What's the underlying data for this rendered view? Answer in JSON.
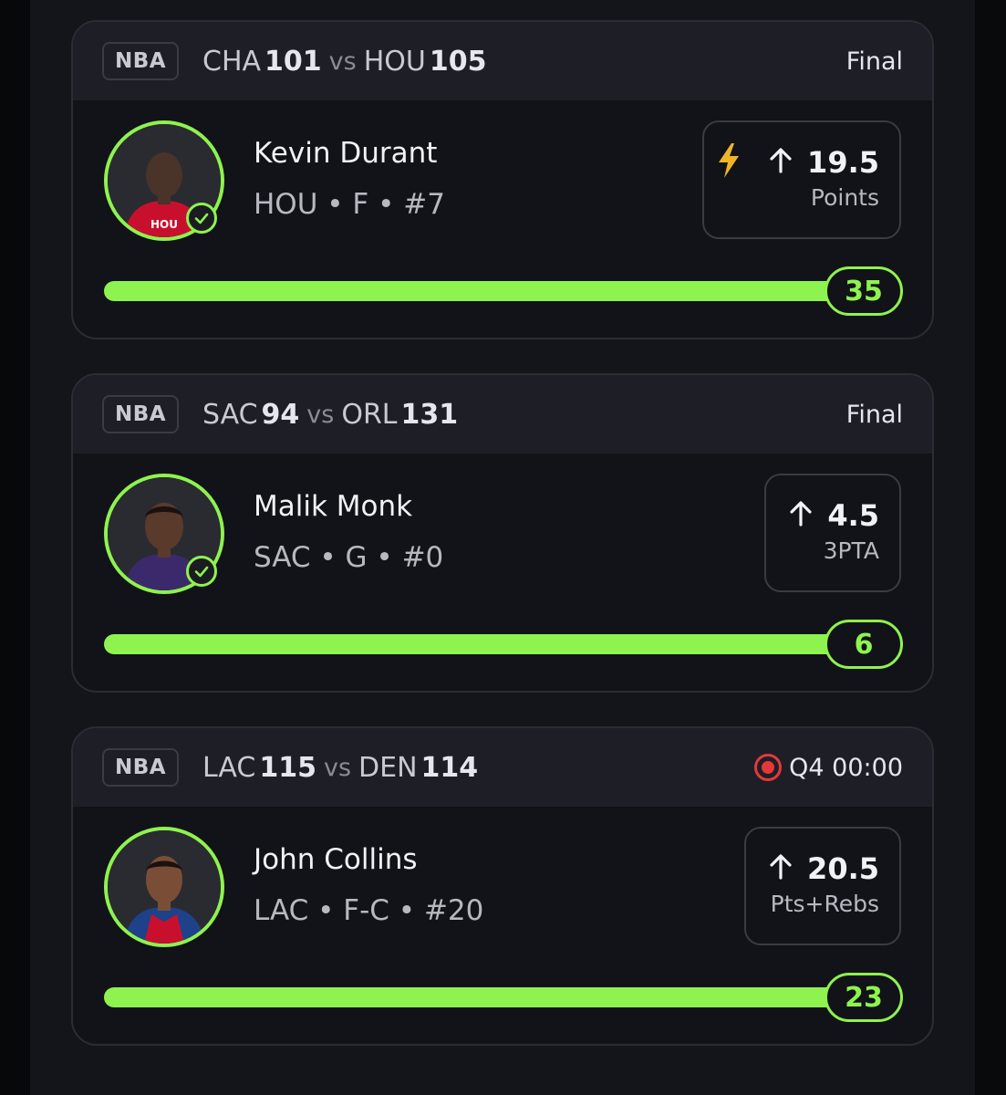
{
  "theme": {
    "accent": "#8ef34e",
    "live": "#e5383b",
    "bolt": "#f0b429"
  },
  "picks": [
    {
      "league": "NBA",
      "away": {
        "team": "CHA",
        "score": "101"
      },
      "vs": "vs",
      "home": {
        "team": "HOU",
        "score": "105"
      },
      "status": "Final",
      "live": false,
      "player": {
        "name": "Kevin Durant",
        "meta": "HOU • F • #7",
        "jersey_color": "#c8102e"
      },
      "boost_icon": "lightning-bolt-icon",
      "direction_icon": "arrow-up-icon",
      "line": "19.5",
      "stat": "Points",
      "result": "35",
      "progress": 1.0
    },
    {
      "league": "NBA",
      "away": {
        "team": "SAC",
        "score": "94"
      },
      "vs": "vs",
      "home": {
        "team": "ORL",
        "score": "131"
      },
      "status": "Final",
      "live": false,
      "player": {
        "name": "Malik Monk",
        "meta": "SAC • G • #0",
        "jersey_color": "#3b2a6b"
      },
      "direction_icon": "arrow-up-icon",
      "line": "4.5",
      "stat": "3PTA",
      "result": "6",
      "progress": 1.0
    },
    {
      "league": "NBA",
      "away": {
        "team": "LAC",
        "score": "115"
      },
      "vs": "vs",
      "home": {
        "team": "DEN",
        "score": "114"
      },
      "status": "Q4 00:00",
      "live": true,
      "player": {
        "name": "John Collins",
        "meta": "LAC • F-C • #20",
        "jersey_color": "#1d428a"
      },
      "direction_icon": "arrow-up-icon",
      "line": "20.5",
      "stat": "Pts+Rebs",
      "result": "23",
      "progress": 1.0
    }
  ]
}
